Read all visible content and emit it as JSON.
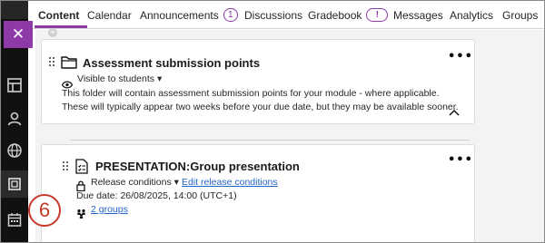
{
  "nav": {
    "tabs": [
      {
        "label": "Content",
        "active": true
      },
      {
        "label": "Calendar"
      },
      {
        "label": "Announcements",
        "badge": "1"
      },
      {
        "label": "Discussions"
      },
      {
        "label": "Gradebook",
        "badge": "!"
      },
      {
        "label": "Messages"
      },
      {
        "label": "Analytics"
      },
      {
        "label": "Groups"
      }
    ],
    "accent_color": "#8d3aa8"
  },
  "close_button": {
    "icon": "close-icon",
    "glyph": "✕"
  },
  "rail_icons": [
    "course-outline-icon",
    "people-icon",
    "globe-icon",
    "content-page-icon",
    "calendar-icon"
  ],
  "folder_card": {
    "title": "Assessment submission points",
    "visibility": "Visible to students",
    "description_line1": "This folder will contain assessment submission points for your module - where applicable.",
    "description_line2": "These will typically appear two weeks before your due date, but they may be available sooner.",
    "menu_glyph": "•••"
  },
  "assignment_card": {
    "title": "PRESENTATION:Group presentation",
    "release_conditions": "Release conditions",
    "edit_release_conditions": "Edit release conditions",
    "due_date": "Due date: 26/08/2025, 14:00 (UTC+1)",
    "groups_link": "2 groups",
    "menu_glyph": "•••"
  },
  "step_marker": "6",
  "colors": {
    "step_marker": "#c43a2a",
    "link": "#2565c7",
    "rail": "#111111"
  }
}
